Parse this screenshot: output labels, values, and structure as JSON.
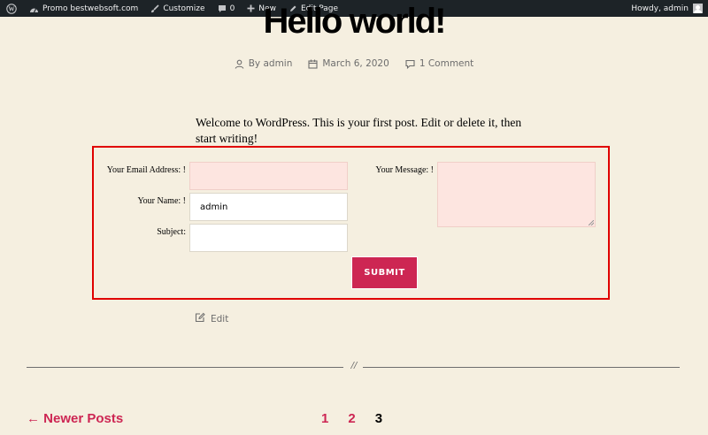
{
  "admin_bar": {
    "site_name": "Promo bestwebsoft.com",
    "customize": "Customize",
    "comments_count": "0",
    "new": "New",
    "edit_page": "Edit Page",
    "howdy": "Howdy, admin"
  },
  "post": {
    "title": "Hello world!",
    "author": "By admin",
    "date": "March 6, 2020",
    "comments": "1 Comment",
    "body": "Welcome to WordPress. This is your first post. Edit or delete it, then start writing!",
    "edit": "Edit"
  },
  "form": {
    "email_label": "Your Email Address: !",
    "email_value": "",
    "name_label": "Your Name: !",
    "name_value": "admin",
    "subject_label": "Subject:",
    "subject_value": "",
    "message_label": "Your Message: !",
    "message_value": "",
    "submit_label": "SUBMIT",
    "error_color": "#fde5e0",
    "highlight_border_color": "#e00000"
  },
  "separator": "//",
  "pagination": {
    "newer": "← Newer Posts",
    "pages": [
      "1",
      "2",
      "3"
    ],
    "current": "3"
  },
  "colors": {
    "accent": "#cd2653",
    "background": "#f5efe0",
    "admin_bar": "#1d2327"
  },
  "icons": {
    "wp_logo": "wordpress-icon",
    "dashboard": "dashboard-icon",
    "customize": "brush-icon",
    "comments": "comment-bubble-icon",
    "new": "plus-icon",
    "edit": "pencil-icon",
    "author": "person-icon",
    "date": "calendar-icon"
  }
}
